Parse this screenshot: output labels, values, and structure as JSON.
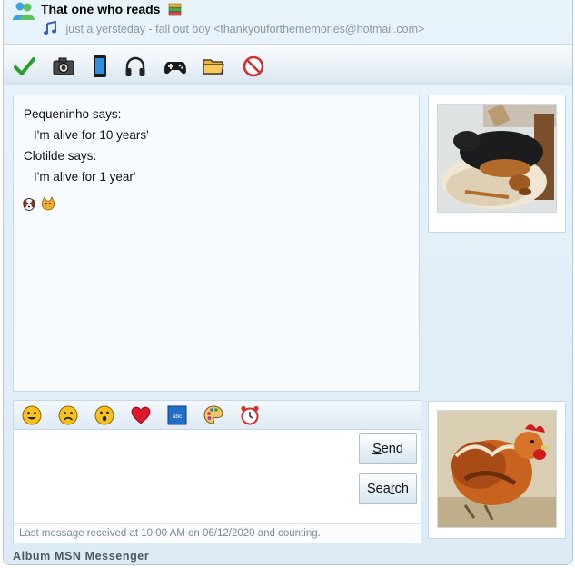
{
  "header": {
    "contact_name": "That one who reads",
    "status_message": "just a yersteday - fall out boy <thankyouforthememories@hotmail.com>"
  },
  "toolbar": {
    "items": [
      {
        "name": "accept",
        "icon": "checkmark-icon"
      },
      {
        "name": "camera",
        "icon": "camera-icon"
      },
      {
        "name": "mobile",
        "icon": "phone-icon"
      },
      {
        "name": "voice",
        "icon": "headphones-icon"
      },
      {
        "name": "games",
        "icon": "gamepad-icon"
      },
      {
        "name": "files",
        "icon": "folder-icon"
      },
      {
        "name": "block",
        "icon": "block-icon"
      }
    ]
  },
  "conversation": {
    "messages": [
      {
        "sender": "Pequeninho says:",
        "text": "I'm alive for 10 years'"
      },
      {
        "sender": "Clotilde says:",
        "text": "I'm alive for 1 year'"
      }
    ]
  },
  "emoticon_bar": {
    "items": [
      "smile-icon",
      "sad-icon",
      "surprised-icon",
      "heart-icon",
      "text-style-icon",
      "palette-icon",
      "alarm-clock-icon"
    ],
    "text_style_label": "abc"
  },
  "compose": {
    "send_label": "Send",
    "search_label": "Search",
    "input_value": ""
  },
  "status_bar": {
    "text": "Last message received at 10:00 AM on 06/12/2020 and counting."
  },
  "app_name": "Album MSN Messenger",
  "colors": {
    "window_bg": "#dcebf6",
    "border": "#c8d8e5",
    "muted_text": "#8a98a6"
  }
}
